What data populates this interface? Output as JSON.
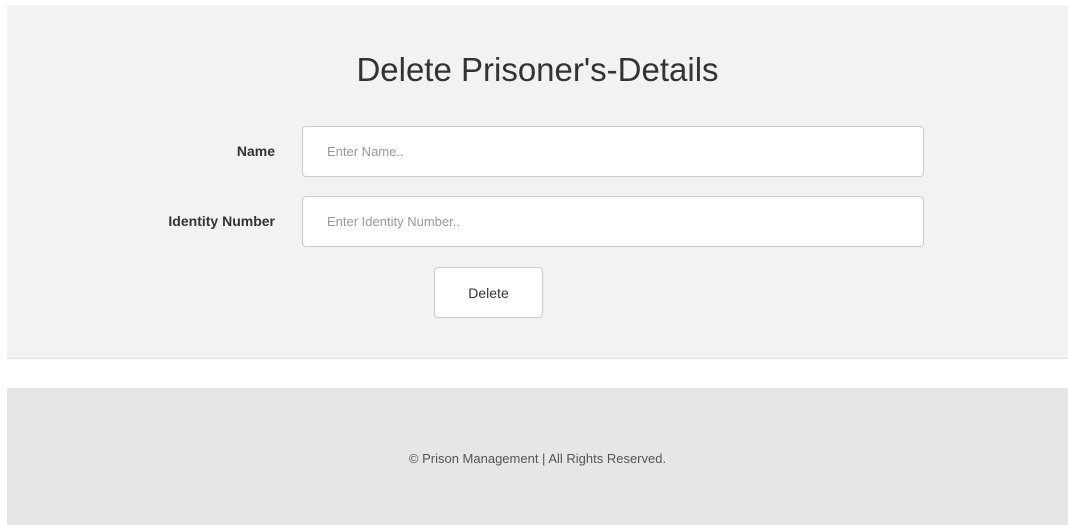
{
  "form": {
    "title": "Delete Prisoner's-Details",
    "fields": {
      "name": {
        "label": "Name",
        "placeholder": "Enter Name..",
        "value": ""
      },
      "identity_number": {
        "label": "Identity Number",
        "placeholder": "Enter Identity Number..",
        "value": ""
      }
    },
    "submit_label": "Delete"
  },
  "footer": {
    "text": "© Prison Management | All Rights Reserved."
  },
  "colors": {
    "panel_background": "#f2f2f2",
    "footer_background": "#e6e6e6",
    "input_border": "#cccccc",
    "text": "#333333"
  }
}
